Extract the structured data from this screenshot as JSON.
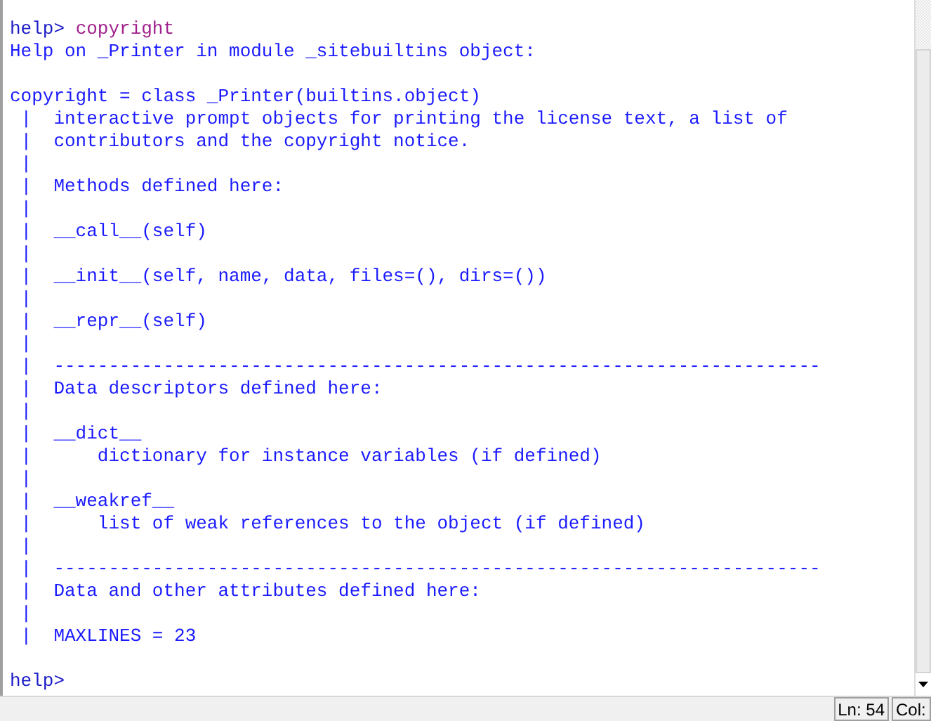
{
  "console": {
    "lines": [
      {
        "kind": "prompt",
        "prompt": "help>",
        "command": "copyright"
      },
      {
        "kind": "text",
        "text": "Help on _Printer in module _sitebuiltins object:"
      },
      {
        "kind": "blank"
      },
      {
        "kind": "text",
        "text": "copyright = class _Printer(builtins.object)"
      },
      {
        "kind": "text",
        "text": " |  interactive prompt objects for printing the license text, a list of"
      },
      {
        "kind": "text",
        "text": " |  contributors and the copyright notice."
      },
      {
        "kind": "text",
        "text": " |"
      },
      {
        "kind": "text",
        "text": " |  Methods defined here:"
      },
      {
        "kind": "text",
        "text": " |"
      },
      {
        "kind": "text",
        "text": " |  __call__(self)"
      },
      {
        "kind": "text",
        "text": " |"
      },
      {
        "kind": "text",
        "text": " |  __init__(self, name, data, files=(), dirs=())"
      },
      {
        "kind": "text",
        "text": " |"
      },
      {
        "kind": "text",
        "text": " |  __repr__(self)"
      },
      {
        "kind": "text",
        "text": " |"
      },
      {
        "kind": "text",
        "text": " |  ----------------------------------------------------------------------"
      },
      {
        "kind": "text",
        "text": " |  Data descriptors defined here:"
      },
      {
        "kind": "text",
        "text": " |"
      },
      {
        "kind": "text",
        "text": " |  __dict__"
      },
      {
        "kind": "text",
        "text": " |      dictionary for instance variables (if defined)"
      },
      {
        "kind": "text",
        "text": " |"
      },
      {
        "kind": "text",
        "text": " |  __weakref__"
      },
      {
        "kind": "text",
        "text": " |      list of weak references to the object (if defined)"
      },
      {
        "kind": "text",
        "text": " |"
      },
      {
        "kind": "text",
        "text": " |  ----------------------------------------------------------------------"
      },
      {
        "kind": "text",
        "text": " |  Data and other attributes defined here:"
      },
      {
        "kind": "text",
        "text": " |"
      },
      {
        "kind": "text",
        "text": " |  MAXLINES = 23"
      },
      {
        "kind": "blank"
      },
      {
        "kind": "prompt",
        "prompt": "help>"
      }
    ]
  },
  "status_bar": {
    "line": "Ln: 54",
    "column": "Col:"
  }
}
